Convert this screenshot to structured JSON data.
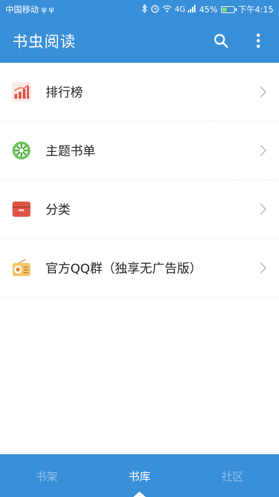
{
  "status_bar": {
    "carrier": "中国移动",
    "usb_icons": "ψ ψ",
    "network": "4G",
    "battery_percent": "45%",
    "battery_level": 0.45,
    "time": "下午4:15"
  },
  "app_bar": {
    "title": "书虫阅读",
    "search_icon": "search-icon",
    "more_icon": "more-vert-icon"
  },
  "menu": {
    "items": [
      {
        "label": "排行榜",
        "icon": "ranking-chart-icon"
      },
      {
        "label": "主题书单",
        "icon": "theme-booklist-icon"
      },
      {
        "label": "分类",
        "icon": "category-box-icon"
      },
      {
        "label": "官方QQ群（独享无广告版）",
        "icon": "radio-icon"
      }
    ]
  },
  "bottom_nav": {
    "tabs": [
      {
        "label": "书架",
        "active": false
      },
      {
        "label": "书库",
        "active": true
      },
      {
        "label": "社区",
        "active": false
      }
    ]
  },
  "colors": {
    "primary": "#3a8fd9",
    "inactive_tab": "#8ec1ec",
    "text": "#222222"
  }
}
